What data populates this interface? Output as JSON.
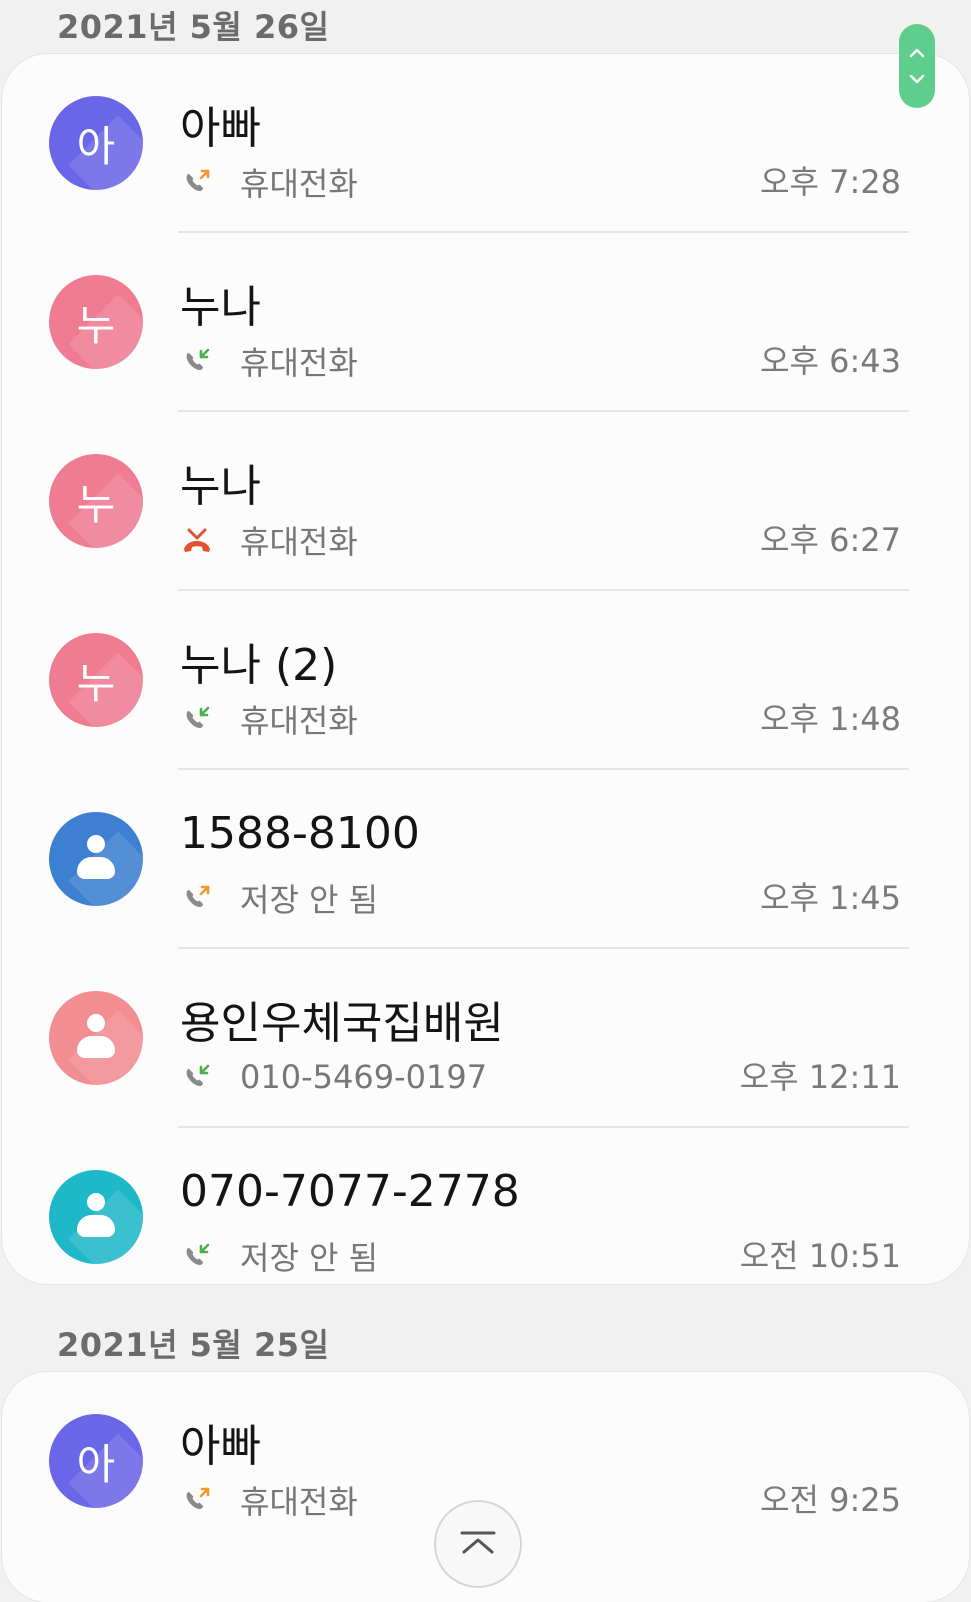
{
  "sections": [
    {
      "date": "2021년 5월 26일",
      "calls": [
        {
          "name": "아빠",
          "avatar_text": "아",
          "avatar_type": "letter",
          "avatar_color": "#6a66e8",
          "call_type": "outgoing",
          "call_icon": "outgoing-call-icon",
          "sub": "휴대전화",
          "time": "오후 7:28"
        },
        {
          "name": "누나",
          "avatar_text": "누",
          "avatar_type": "letter",
          "avatar_color": "#f07c92",
          "call_type": "incoming",
          "call_icon": "incoming-call-icon",
          "sub": "휴대전화",
          "time": "오후 6:43"
        },
        {
          "name": "누나",
          "avatar_text": "누",
          "avatar_type": "letter",
          "avatar_color": "#f07c92",
          "call_type": "missed",
          "call_icon": "missed-call-icon",
          "sub": "휴대전화",
          "time": "오후 6:27"
        },
        {
          "name": "누나 (2)",
          "avatar_text": "누",
          "avatar_type": "letter",
          "avatar_color": "#f07c92",
          "call_type": "incoming",
          "call_icon": "incoming-call-icon",
          "sub": "휴대전화",
          "time": "오후 1:48"
        },
        {
          "name": "1588-8100",
          "avatar_text": "",
          "avatar_type": "person",
          "avatar_color": "#3d7fd0",
          "call_type": "outgoing",
          "call_icon": "outgoing-call-icon",
          "sub": "저장 안 됨",
          "time": "오후 1:45"
        },
        {
          "name": "용인우체국집배원",
          "avatar_text": "",
          "avatar_type": "person",
          "avatar_color": "#f28d92",
          "call_type": "incoming",
          "call_icon": "incoming-call-icon",
          "sub": "010-5469-0197",
          "time": "오후 12:11"
        },
        {
          "name": "070-7077-2778",
          "avatar_text": "",
          "avatar_type": "person",
          "avatar_color": "#1fb8c8",
          "call_type": "incoming",
          "call_icon": "incoming-call-icon",
          "sub": "저장 안 됨",
          "time": "오전 10:51"
        }
      ]
    },
    {
      "date": "2021년 5월 25일",
      "calls": [
        {
          "name": "아빠",
          "avatar_text": "아",
          "avatar_type": "letter",
          "avatar_color": "#6a66e8",
          "call_type": "outgoing",
          "call_icon": "outgoing-call-icon",
          "sub": "휴대전화",
          "time": "오전 9:25"
        }
      ]
    }
  ],
  "colors": {
    "outgoing_arrow": "#f29a2e",
    "incoming_arrow": "#4caf50",
    "missed": "#e4522b",
    "scroll_handle": "#5fce8c"
  },
  "scroll_handle_icons": [
    "chevron-up-icon",
    "chevron-down-icon"
  ],
  "scroll_to_top_icon": "scroll-to-top-icon"
}
